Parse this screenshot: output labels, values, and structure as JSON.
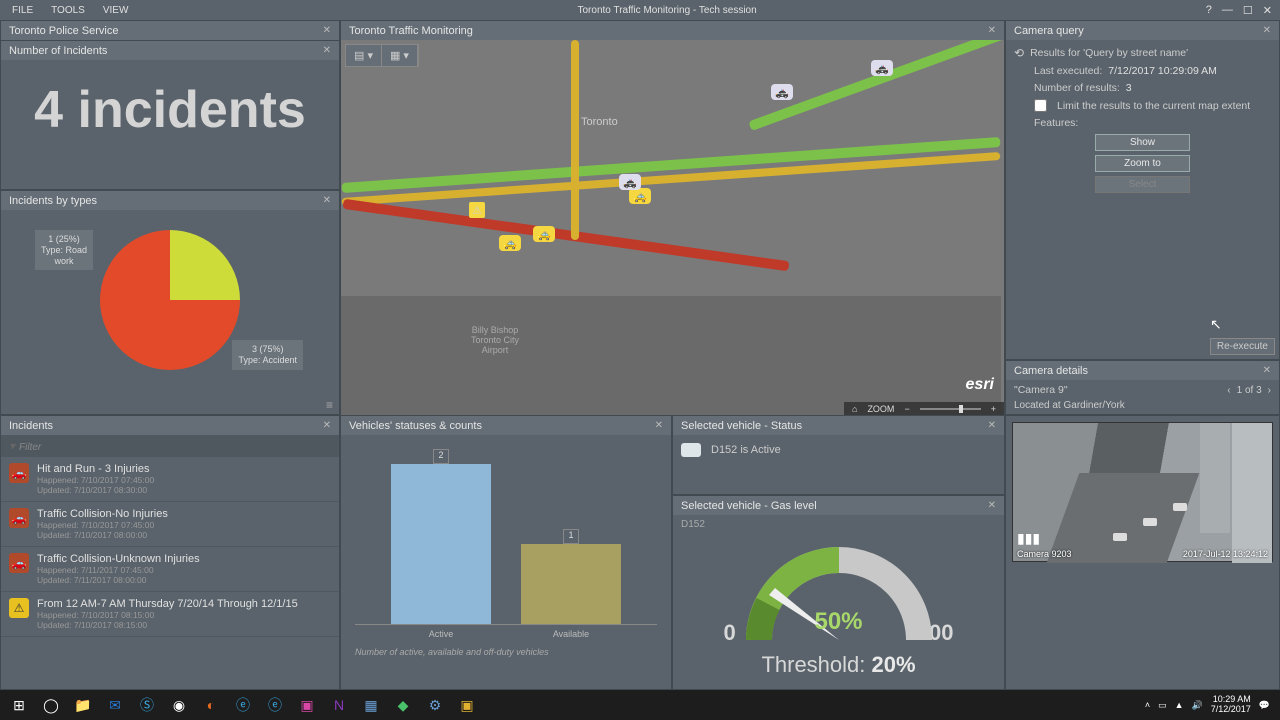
{
  "app": {
    "title": "Toronto Traffic Monitoring - Tech session",
    "menus": [
      "FILE",
      "TOOLS",
      "VIEW"
    ]
  },
  "panels": {
    "tps_title": "Toronto Police Service",
    "count": {
      "title": "Number of Incidents",
      "big": "4 incidents"
    },
    "types": {
      "title": "Incidents by types",
      "label1": "1 (25%)\nType: Road\nwork",
      "label2": "3 (75%)\nType: Accident"
    },
    "incidents": {
      "title": "Incidents",
      "filter": "Filter",
      "items": [
        {
          "title": "Hit and Run - 3 Injuries",
          "happened": "Happened: 7/10/2017 07:45:00",
          "updated": "Updated: 7/10/2017 08:30:00",
          "icon": "acc"
        },
        {
          "title": "Traffic Collision-No Injuries",
          "happened": "Happened: 7/10/2017 07:45:00",
          "updated": "Updated: 7/10/2017 08:00:00",
          "icon": "acc"
        },
        {
          "title": "Traffic Collision-Unknown Injuries",
          "happened": "Happened: 7/11/2017 07:45:00",
          "updated": "Updated: 7/11/2017 08:00:00",
          "icon": "acc"
        },
        {
          "title": "From 12 AM-7 AM Thursday 7/20/14 Through 12/1/15",
          "happened": "Happened: 7/10/2017 08:15:00",
          "updated": "Updated: 7/10/2017 08:15:00",
          "icon": "warn"
        }
      ]
    },
    "map": {
      "title": "Toronto Traffic Monitoring",
      "city": "Toronto",
      "airport": "Billy Bishop\nToronto City\nAirport",
      "zoom_label": "ZOOM",
      "esri": "esri"
    },
    "vstat": {
      "title": "Vehicles' statuses & counts",
      "note": "Number of active, available and off-duty vehicles"
    },
    "sel": {
      "title": "Selected vehicle - Status",
      "text": "D152 is Active"
    },
    "gas": {
      "title": "Selected vehicle - Gas level",
      "vehicle": "D152",
      "pct": "50%",
      "min": "0",
      "max": "100",
      "threshold_lbl": "Threshold: ",
      "threshold_val": "20%"
    },
    "query": {
      "title": "Camera query",
      "results_for": "Results for 'Query by street name'",
      "last_exec_lbl": "Last executed:",
      "last_exec_val": "7/12/2017 10:29:09 AM",
      "num_lbl": "Number of results:",
      "num_val": "3",
      "limit_chk": "Limit the results to the current map extent",
      "features": "Features:",
      "btn_show": "Show",
      "btn_zoom": "Zoom to",
      "btn_select": "Select",
      "reexec": "Re-execute"
    },
    "camdetails": {
      "title": "Camera details",
      "name": "\"Camera 9\"",
      "page": "1 of 3",
      "loc": "Located at Gardiner/York"
    },
    "camimg": {
      "label": "Camera 9203",
      "stamp": "2017-Jul-12 13:24:12"
    }
  },
  "chart_data": [
    {
      "type": "pie",
      "title": "Incidents by types",
      "categories": [
        "Road work",
        "Accident"
      ],
      "values": [
        1,
        3
      ],
      "percent": [
        25,
        75
      ],
      "colors": [
        "#cddc39",
        "#e34a2a"
      ]
    },
    {
      "type": "bar",
      "title": "Vehicles' statuses & counts",
      "categories": [
        "Active",
        "Available"
      ],
      "values": [
        2,
        1
      ],
      "colors": [
        "#8fb8d8",
        "#a8a060"
      ],
      "ylim": [
        0,
        2.2
      ],
      "note": "Number of active, available and off-duty vehicles"
    },
    {
      "type": "gauge",
      "title": "Selected vehicle - Gas level",
      "value": 50,
      "min": 0,
      "max": 100,
      "threshold": 20,
      "unit": "%"
    }
  ],
  "taskbar": {
    "time": "10:29 AM",
    "date": "7/12/2017"
  }
}
